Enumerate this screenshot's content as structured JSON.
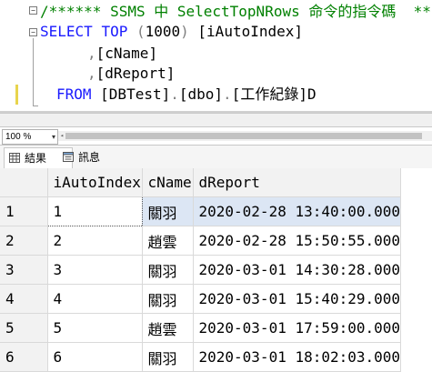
{
  "editor": {
    "comment_line": "/****** SSMS 中 SelectTopNRows 命令的指令碼  ******",
    "fold_symbol": "−",
    "line1": {
      "select": "SELECT",
      "top": "TOP",
      "paren_open": " (",
      "top_count": "1000",
      "paren_close": ")",
      "col": " [iAutoIndex]"
    },
    "line2": {
      "comma": ",",
      "col": "[cName]"
    },
    "line3": {
      "comma": ",",
      "col": "[dReport]"
    },
    "line4": {
      "from": "FROM",
      "db": " [DBTest]",
      "dot1": ".",
      "schema": "[dbo]",
      "dot2": ".",
      "table": "[工作紀錄]",
      "suffix": "D"
    }
  },
  "zoom": {
    "value": "100 %",
    "arrow": "▾"
  },
  "tabs": {
    "results": "結果",
    "messages": "訊息"
  },
  "results": {
    "columns": [
      "iAutoIndex",
      "cName",
      "dReport"
    ],
    "rows": [
      {
        "n": "1",
        "iAutoIndex": "1",
        "cName": "關羽",
        "dReport": "2020-02-28 13:40:00.000"
      },
      {
        "n": "2",
        "iAutoIndex": "2",
        "cName": "趙雲",
        "dReport": "2020-02-28 15:50:55.000"
      },
      {
        "n": "3",
        "iAutoIndex": "3",
        "cName": "關羽",
        "dReport": "2020-03-01 14:30:28.000"
      },
      {
        "n": "4",
        "iAutoIndex": "4",
        "cName": "關羽",
        "dReport": "2020-03-01 15:40:29.000"
      },
      {
        "n": "5",
        "iAutoIndex": "5",
        "cName": "趙雲",
        "dReport": "2020-03-01 17:59:00.000"
      },
      {
        "n": "6",
        "iAutoIndex": "6",
        "cName": "關羽",
        "dReport": "2020-03-01 18:02:03.000"
      }
    ]
  },
  "colors": {
    "keyword": "#1a1aff",
    "comment": "#008000",
    "selection": "#dce6f4"
  }
}
